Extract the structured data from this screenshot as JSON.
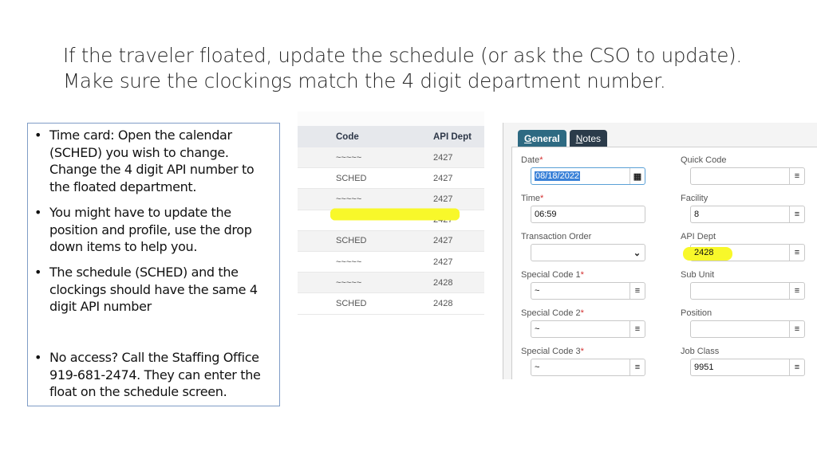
{
  "slide": {
    "title_lines": [
      "If the traveler floated, update the schedule (or ask the CSO to update).",
      "Make sure the clockings match the 4 digit department number."
    ],
    "bullets": [
      "Time card: Open the calendar (SCHED) you wish to change. Change the 4 digit API number to the floated department.",
      "You might have to update the position and profile, use the drop down items to help you.",
      "The schedule (SCHED) and the clockings should have the same 4 digit API number",
      "No access?  Call the Staffing Office 919-681-2474.  They can enter the float on the schedule screen."
    ],
    "bullet_glyph": "•"
  },
  "grid": {
    "columns": [
      "Code",
      "API Dept"
    ],
    "rows": [
      {
        "code": "~~~~~",
        "dept": "2427",
        "highlighted": false
      },
      {
        "code": "SCHED",
        "dept": "2427",
        "highlighted": false
      },
      {
        "code": "~~~~~",
        "dept": "2427",
        "highlighted": false
      },
      {
        "code": "~~~~~",
        "dept": "2427",
        "highlighted": false
      },
      {
        "code": "SCHED",
        "dept": "2427",
        "highlighted": false
      },
      {
        "code": "~~~~~",
        "dept": "2427",
        "highlighted": false
      },
      {
        "code": "~~~~~",
        "dept": "2428",
        "highlighted": true
      },
      {
        "code": "SCHED",
        "dept": "2428",
        "highlighted": true
      }
    ]
  },
  "form": {
    "tabs": [
      {
        "accel": "G",
        "rest": "eneral",
        "active": true
      },
      {
        "accel": "N",
        "rest": "otes",
        "active": false
      }
    ],
    "fields": {
      "date": {
        "label": "Date",
        "required": "*",
        "value": "08/18/2022",
        "icon": "calendar-icon"
      },
      "quick_code": {
        "label": "Quick Code",
        "value": "",
        "icon": "list-icon"
      },
      "time": {
        "label": "Time",
        "required": "*",
        "value": "06:59"
      },
      "facility": {
        "label": "Facility",
        "value": "8",
        "icon": "list-icon"
      },
      "transaction_order": {
        "label": "Transaction Order",
        "value": "",
        "icon": "chevron-down-icon"
      },
      "api_dept": {
        "label": "API Dept",
        "value": "2428",
        "icon": "list-icon"
      },
      "special_code_1": {
        "label": "Special Code 1",
        "required": "*",
        "value": "~",
        "icon": "list-icon"
      },
      "sub_unit": {
        "label": "Sub Unit",
        "value": "",
        "icon": "list-icon"
      },
      "special_code_2": {
        "label": "Special Code 2",
        "required": "*",
        "value": "~",
        "icon": "list-icon"
      },
      "position": {
        "label": "Position",
        "value": "",
        "icon": "list-icon"
      },
      "special_code_3": {
        "label": "Special Code 3",
        "required": "*",
        "value": "~",
        "icon": "list-icon"
      },
      "job_class": {
        "label": "Job Class",
        "value": "9951",
        "icon": "list-icon"
      }
    },
    "glyphs": {
      "list": "≡",
      "calendar": "▦",
      "chevron": "⌄"
    },
    "colors": {
      "tab_active": "#2e6a82",
      "tab_inactive": "#2b3b4a",
      "highlight": "#f8f82a",
      "required": "#d32f2f"
    }
  }
}
